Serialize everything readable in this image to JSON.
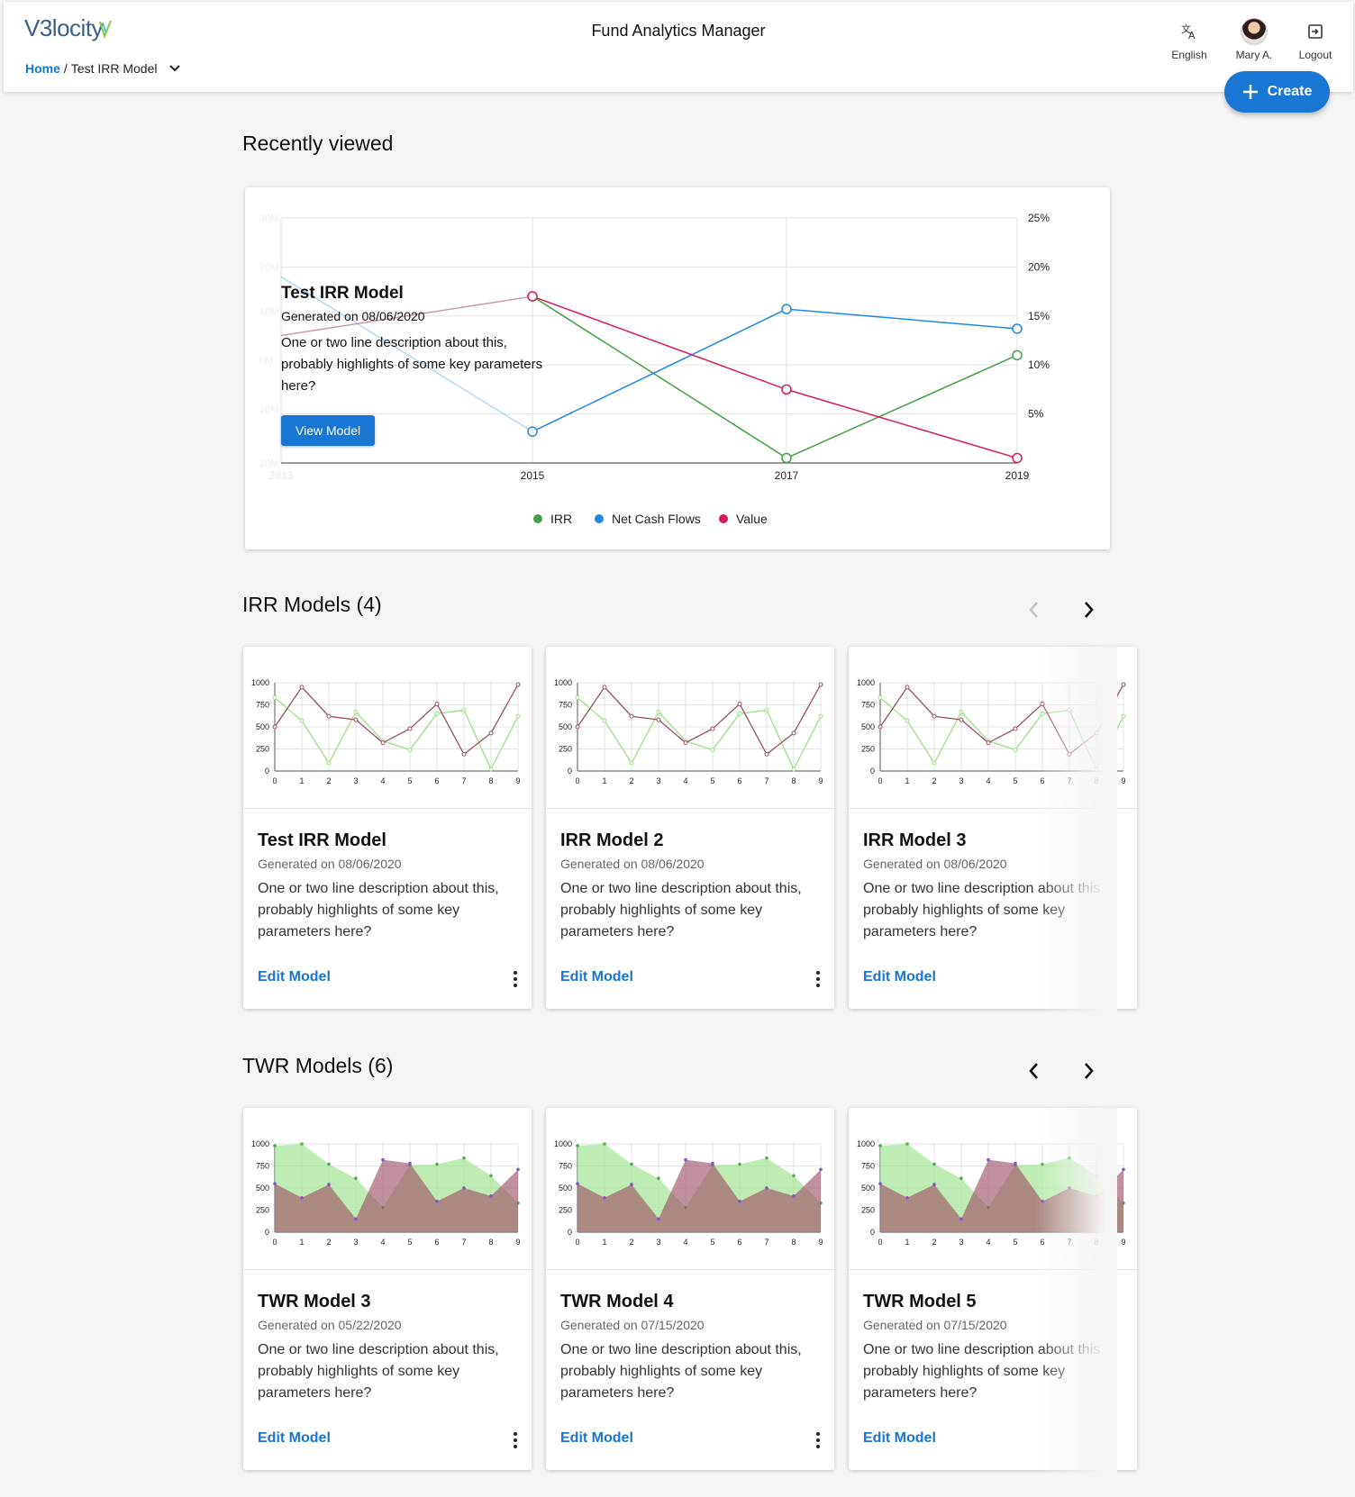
{
  "header": {
    "logo_text": "V3locity",
    "app_title": "Fund Analytics Manager",
    "breadcrumb": {
      "home": "Home",
      "separator": "/",
      "current": "Test IRR Model"
    },
    "actions": [
      {
        "label": "English",
        "icon": "translate-icon"
      },
      {
        "label": "Mary A.",
        "icon": "avatar"
      },
      {
        "label": "Logout",
        "icon": "logout-icon"
      }
    ],
    "create_label": "Create"
  },
  "recent": {
    "heading": "Recently viewed",
    "title": "Test IRR Model",
    "date": "Generated on 08/06/2020",
    "description": "One or two line description about this, probably highlights of some key parameters here?",
    "button": "View Model"
  },
  "chart_data": [
    {
      "type": "line",
      "categories": [
        "2013",
        "2015",
        "2017",
        "2019"
      ],
      "y_left_ticks": [
        "20M",
        "10M",
        "0M",
        "10M",
        "20M",
        "30M"
      ],
      "y_right_ticks": [
        "5%",
        "10%",
        "15%",
        "20%",
        "25%"
      ],
      "ylim_right": [
        0,
        25
      ],
      "series": [
        {
          "name": "IRR",
          "color": "#43a047",
          "values": [
            13,
            17,
            0.5,
            11
          ]
        },
        {
          "name": "Net Cash Flows",
          "color": "#1e88e5",
          "values": [
            19,
            3.2,
            15.7,
            13.7
          ]
        },
        {
          "name": "Value",
          "color": "#d81b60",
          "values": [
            13,
            17,
            7.5,
            0.5
          ]
        }
      ],
      "legend": "bottom"
    },
    {
      "type": "line",
      "x": [
        0,
        1,
        2,
        3,
        4,
        5,
        6,
        7,
        8,
        9
      ],
      "y_ticks": [
        "0",
        "250",
        "500",
        "750",
        "1000"
      ],
      "ylim": [
        0,
        1000
      ],
      "series": [
        {
          "color": "#9ddc8a",
          "values": [
            830,
            570,
            90,
            670,
            340,
            240,
            650,
            690,
            20,
            620
          ]
        },
        {
          "color": "#9a4f63",
          "values": [
            500,
            950,
            620,
            580,
            320,
            480,
            760,
            190,
            430,
            980
          ]
        }
      ]
    },
    {
      "type": "area",
      "x": [
        0,
        1,
        2,
        3,
        4,
        5,
        6,
        7,
        8,
        9
      ],
      "y_ticks": [
        "0",
        "250",
        "500",
        "750",
        "1000"
      ],
      "ylim": [
        0,
        1000
      ],
      "series": [
        {
          "color": "#a8e69a",
          "values": [
            980,
            1000,
            770,
            610,
            280,
            760,
            770,
            840,
            640,
            330
          ]
        },
        {
          "color": "#a2546a",
          "values": [
            550,
            390,
            540,
            150,
            820,
            780,
            350,
            500,
            410,
            710
          ]
        }
      ]
    }
  ],
  "irr": {
    "heading": "IRR Models (4)",
    "cards": [
      {
        "title": "Test IRR Model",
        "date": "Generated on 08/06/2020",
        "description": "One or two line description about this, probably highlights of some key parameters here?",
        "action": "Edit Model"
      },
      {
        "title": "IRR Model 2",
        "date": "Generated on 08/06/2020",
        "description": "One or two line description about this, probably highlights of some key parameters here?",
        "action": "Edit Model"
      },
      {
        "title": "IRR Model 3",
        "date": "Generated on 08/06/2020",
        "description": "One or two line description about this, probably highlights of some key parameters here?",
        "action": "Edit Model"
      }
    ]
  },
  "twr": {
    "heading": "TWR Models (6)",
    "cards": [
      {
        "title": "TWR Model 3",
        "date": "Generated on 05/22/2020",
        "description": "One or two line description about this, probably highlights of some key parameters here?",
        "action": "Edit Model"
      },
      {
        "title": "TWR Model 4",
        "date": "Generated on 07/15/2020",
        "description": "One or two line description about this, probably highlights of some key parameters here?",
        "action": "Edit Model"
      },
      {
        "title": "TWR Model 5",
        "date": "Generated on 07/15/2020",
        "description": "One or two line description about this, probably highlights of some key parameters here?",
        "action": "Edit Model"
      }
    ]
  }
}
